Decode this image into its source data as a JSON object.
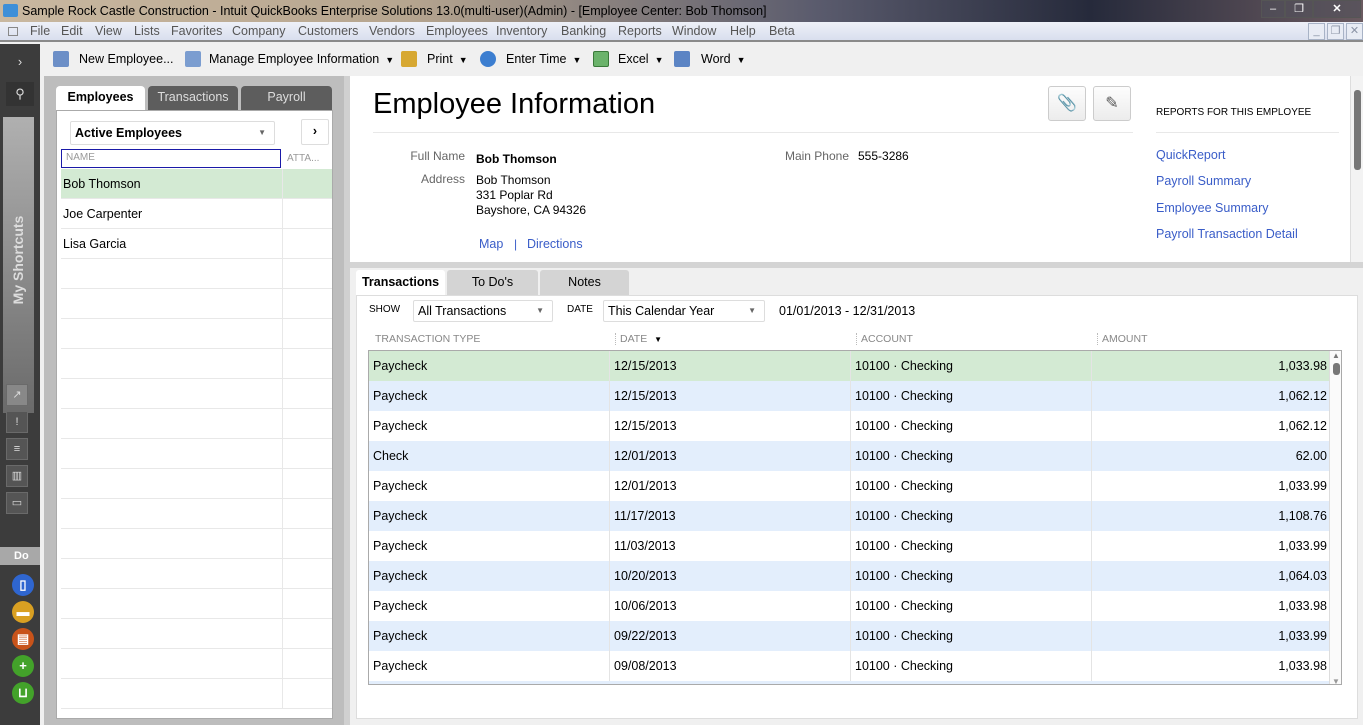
{
  "window": {
    "title": "Sample Rock Castle Construction  - Intuit QuickBooks Enterprise Solutions 13.0(multi-user)(Admin) - [Employee Center: Bob Thomson]",
    "controls": [
      "minimize",
      "restore",
      "close"
    ]
  },
  "menu": {
    "items": [
      "File",
      "Edit",
      "View",
      "Lists",
      "Favorites",
      "Company",
      "Customers",
      "Vendors",
      "Employees",
      "Inventory",
      "Banking",
      "Reports",
      "Window",
      "Help",
      "Beta"
    ]
  },
  "toolbar": {
    "new_employee": "New Employee...",
    "manage_info": "Manage Employee Information",
    "print": "Print",
    "enter_time": "Enter Time",
    "excel": "Excel",
    "word": "Word"
  },
  "leftbar": {
    "shortcuts_label": "My Shortcuts",
    "do_more": "Do M"
  },
  "employee_list": {
    "tabs": [
      "Employees",
      "Transactions",
      "Payroll"
    ],
    "active_tab": "Employees",
    "filter": "Active Employees",
    "columns": [
      "NAME",
      "ATTA..."
    ],
    "rows": [
      {
        "name": "Bob Thomson",
        "selected": true
      },
      {
        "name": "Joe Carpenter",
        "selected": false
      },
      {
        "name": "Lisa Garcia",
        "selected": false
      }
    ]
  },
  "info": {
    "title": "Employee Information",
    "full_name_label": "Full Name",
    "full_name": "Bob Thomson",
    "address_label": "Address",
    "address_lines": [
      "Bob Thomson",
      "331 Poplar Rd",
      "Bayshore, CA 94326"
    ],
    "main_phone_label": "Main Phone",
    "main_phone": "555-3286",
    "map_link": "Map",
    "separator": "|",
    "directions_link": "Directions",
    "reports_heading": "REPORTS FOR THIS EMPLOYEE",
    "reports": [
      "QuickReport",
      "Payroll Summary",
      "Employee Summary",
      "Payroll Transaction Detail"
    ]
  },
  "transactions": {
    "tabs": [
      "Transactions",
      "To Do's",
      "Notes"
    ],
    "active_tab": "Transactions",
    "show_label": "SHOW",
    "show_value": "All Transactions",
    "date_label": "DATE",
    "date_value": "This Calendar Year",
    "date_range": "01/01/2013 - 12/31/2013",
    "columns": [
      "TRANSACTION TYPE",
      "DATE",
      "ACCOUNT",
      "AMOUNT"
    ],
    "sort_indicator": "▼",
    "rows": [
      {
        "type": "Paycheck",
        "date": "12/15/2013",
        "account": "10100 · Checking",
        "amount": "1,033.98"
      },
      {
        "type": "Paycheck",
        "date": "12/15/2013",
        "account": "10100 · Checking",
        "amount": "1,062.12"
      },
      {
        "type": "Paycheck",
        "date": "12/15/2013",
        "account": "10100 · Checking",
        "amount": "1,062.12"
      },
      {
        "type": "Check",
        "date": "12/01/2013",
        "account": "10100 · Checking",
        "amount": "62.00"
      },
      {
        "type": "Paycheck",
        "date": "12/01/2013",
        "account": "10100 · Checking",
        "amount": "1,033.99"
      },
      {
        "type": "Paycheck",
        "date": "11/17/2013",
        "account": "10100 · Checking",
        "amount": "1,108.76"
      },
      {
        "type": "Paycheck",
        "date": "11/03/2013",
        "account": "10100 · Checking",
        "amount": "1,033.99"
      },
      {
        "type": "Paycheck",
        "date": "10/20/2013",
        "account": "10100 · Checking",
        "amount": "1,064.03"
      },
      {
        "type": "Paycheck",
        "date": "10/06/2013",
        "account": "10100 · Checking",
        "amount": "1,033.98"
      },
      {
        "type": "Paycheck",
        "date": "09/22/2013",
        "account": "10100 · Checking",
        "amount": "1,033.99"
      },
      {
        "type": "Paycheck",
        "date": "09/08/2013",
        "account": "10100 · Checking",
        "amount": "1,033.98"
      }
    ]
  },
  "colors": {
    "selected_row": "#d3ead3",
    "alt_row": "#e3eefc",
    "link": "#3a5dc8"
  }
}
